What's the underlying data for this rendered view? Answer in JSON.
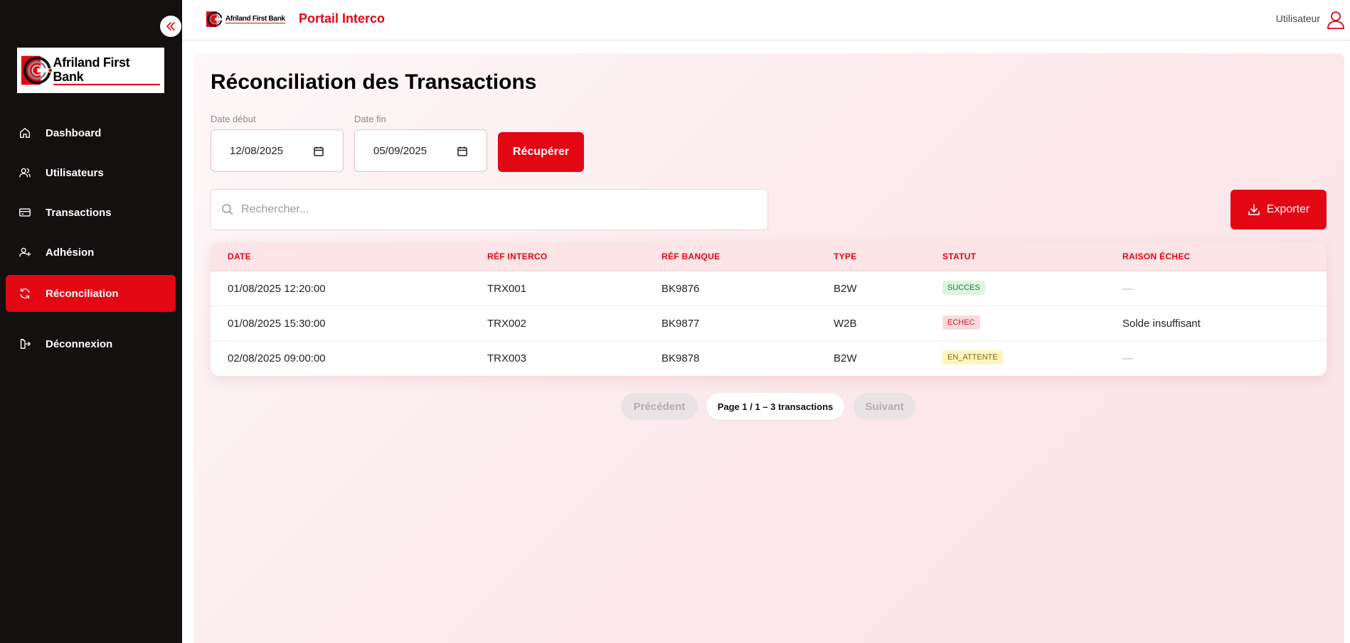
{
  "brand": {
    "logo_text": "Afriland First Bank",
    "accent_color": "#e30613",
    "sidebar_color": "#141010"
  },
  "header": {
    "title": "Portail Interco",
    "user_label": "Utilisateur"
  },
  "sidebar": {
    "items": [
      {
        "label": "Dashboard",
        "icon": "home-icon"
      },
      {
        "label": "Utilisateurs",
        "icon": "users-icon"
      },
      {
        "label": "Transactions",
        "icon": "credit-card-icon"
      },
      {
        "label": "Adhésion",
        "icon": "user-plus-icon"
      },
      {
        "label": "Réconciliation",
        "icon": "refresh-icon",
        "active": true
      },
      {
        "label": "Déconnexion",
        "icon": "logout-icon"
      }
    ]
  },
  "page": {
    "title": "Réconciliation des Transactions"
  },
  "filters": {
    "start_label": "Date début",
    "start_value": "12/08/2025",
    "end_label": "Date fin",
    "end_value": "05/09/2025",
    "fetch_button": "Récupérer"
  },
  "search": {
    "placeholder": "Rechercher..."
  },
  "export_button": "Exporter",
  "table": {
    "columns": [
      "DATE",
      "RÉF INTERCO",
      "RÉF BANQUE",
      "TYPE",
      "STATUT",
      "RAISON ÉCHEC"
    ],
    "rows": [
      {
        "date": "01/08/2025 12:20:00",
        "ref_interco": "TRX001",
        "ref_banque": "BK9876",
        "type": "B2W",
        "statut": "SUCCES",
        "raison": "—"
      },
      {
        "date": "01/08/2025 15:30:00",
        "ref_interco": "TRX002",
        "ref_banque": "BK9877",
        "type": "W2B",
        "statut": "ECHEC",
        "raison": "Solde insuffisant"
      },
      {
        "date": "02/08/2025 09:00:00",
        "ref_interco": "TRX003",
        "ref_banque": "BK9878",
        "type": "B2W",
        "statut": "EN_ATTENTE",
        "raison": "—"
      }
    ]
  },
  "pagination": {
    "prev": "Précédent",
    "info": "Page 1 / 1 – 3 transactions",
    "next": "Suivant"
  }
}
